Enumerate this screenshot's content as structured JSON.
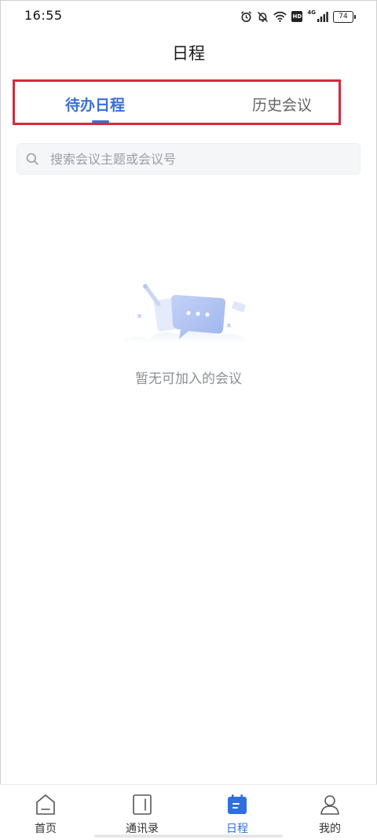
{
  "status_bar": {
    "time": "16:55",
    "network": "4G",
    "hd": "HD",
    "battery": "74"
  },
  "header": {
    "title": "日程"
  },
  "tabs": [
    {
      "label": "待办日程",
      "active": true
    },
    {
      "label": "历史会议",
      "active": false
    }
  ],
  "search": {
    "placeholder": "搜索会议主题或会议号",
    "value": ""
  },
  "empty_state": {
    "message": "暂无可加入的会议"
  },
  "bottom_nav": [
    {
      "label": "首页",
      "icon": "home-icon",
      "active": false
    },
    {
      "label": "通讯录",
      "icon": "contacts-book-icon",
      "active": false
    },
    {
      "label": "日程",
      "icon": "calendar-icon",
      "active": true
    },
    {
      "label": "我的",
      "icon": "profile-icon",
      "active": false
    }
  ],
  "colors": {
    "accent": "#3b6fd8",
    "nav_active": "#2f6fe0",
    "highlight_box": "#d8283c",
    "muted_text": "#8b8f97"
  }
}
